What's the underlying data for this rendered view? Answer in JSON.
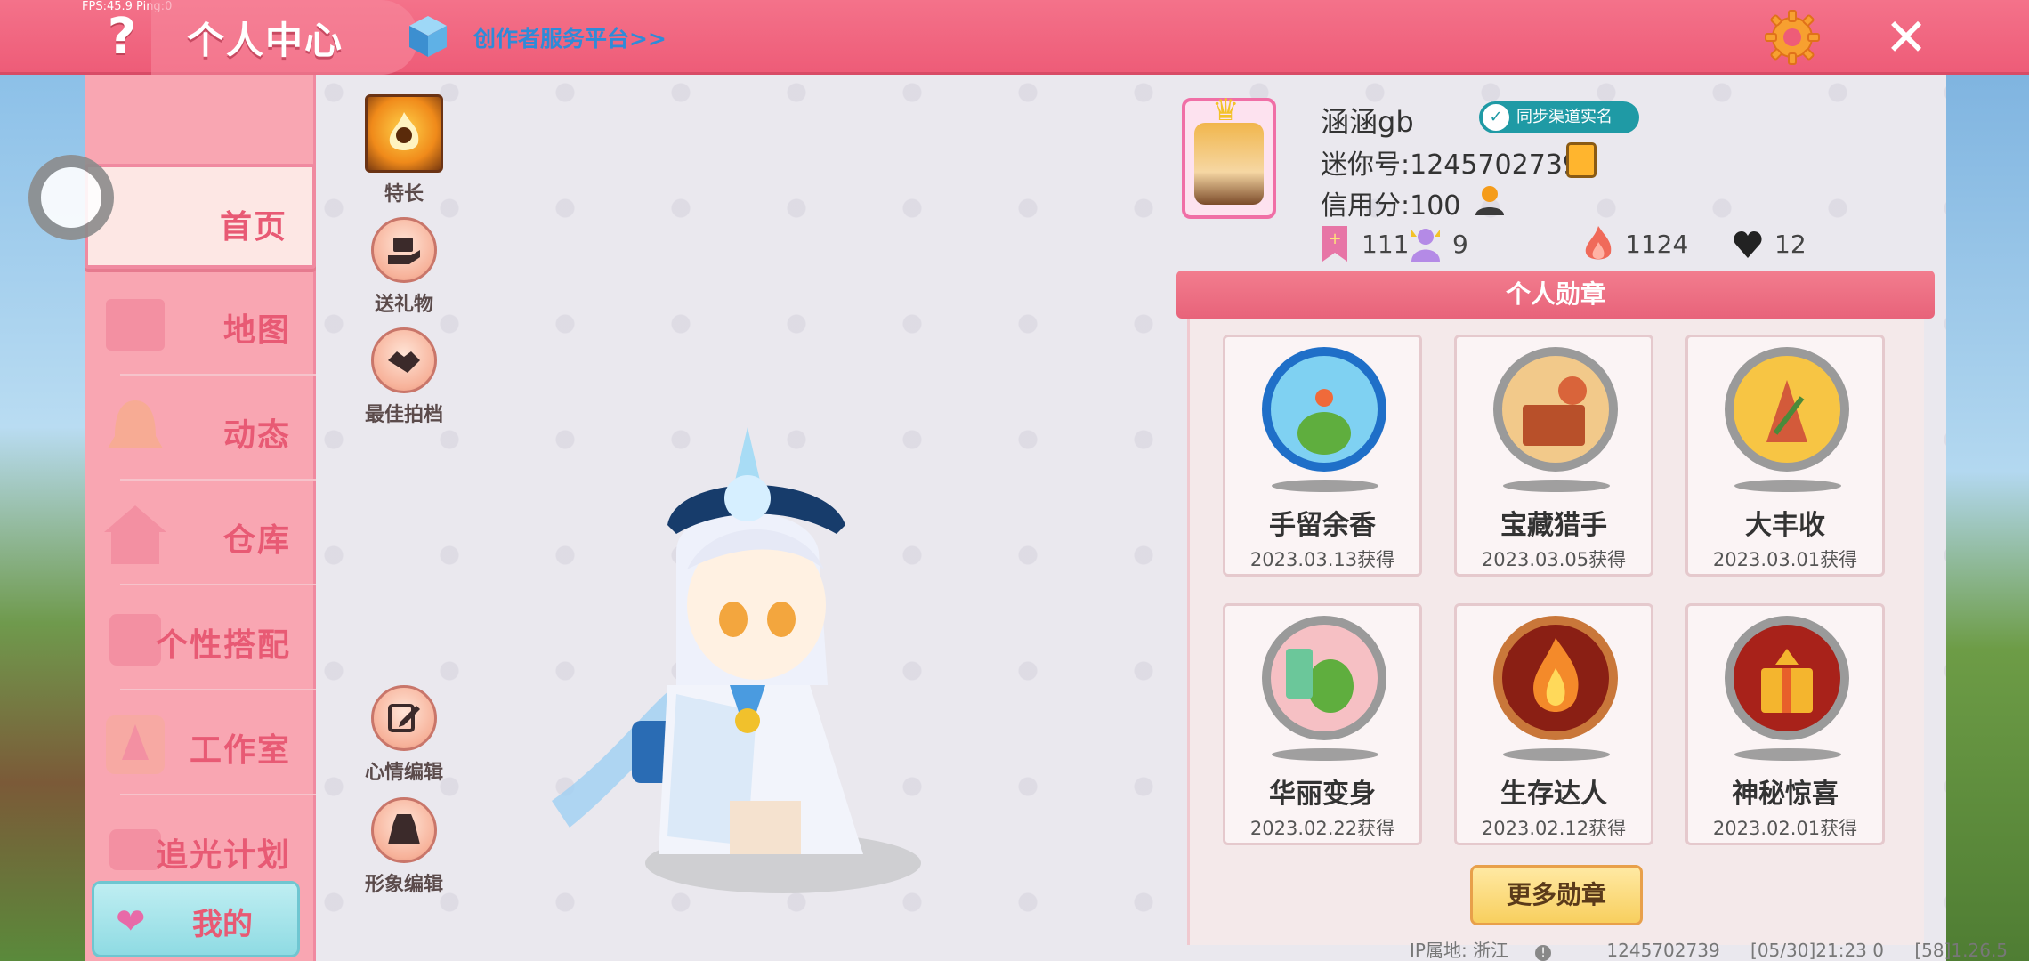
{
  "topbar": {
    "fps": "FPS:45.9  Ping:0",
    "help_icon": "question-mark-icon",
    "title": "个人中心",
    "creator_link": "创作者服务平台>>",
    "settings_icon": "gear-icon",
    "close_icon": "close-icon"
  },
  "sidebar": {
    "items": [
      {
        "label": "首页",
        "active": true
      },
      {
        "label": "地图"
      },
      {
        "label": "动态"
      },
      {
        "label": "仓库"
      },
      {
        "label": "个性搭配"
      },
      {
        "label": "工作室"
      },
      {
        "label": "追光计划"
      }
    ],
    "mine_label": "我的"
  },
  "actions": {
    "specialty": "特长",
    "gift": "送礼物",
    "best_photo": "最佳拍档",
    "mood_edit": "心情编辑",
    "look_edit": "形象编辑"
  },
  "profile": {
    "username": "涵涵gb",
    "sync_badge": "同步渠道实名",
    "mini_id": "迷你号:1245702739",
    "credit": "信用分:100",
    "stats": {
      "bookmark": "111",
      "fans": "9",
      "fire": "1124",
      "likes": "12"
    }
  },
  "medals": {
    "title": "个人勋章",
    "items": [
      {
        "name": "手留余香",
        "date": "2023.03.13获得"
      },
      {
        "name": "宝藏猎手",
        "date": "2023.03.05获得"
      },
      {
        "name": "大丰收",
        "date": "2023.03.01获得"
      },
      {
        "name": "华丽变身",
        "date": "2023.02.22获得"
      },
      {
        "name": "生存达人",
        "date": "2023.02.12获得"
      },
      {
        "name": "神秘惊喜",
        "date": "2023.02.01获得"
      }
    ],
    "more_button": "更多勋章"
  },
  "footer": {
    "ip": "IP属地: 浙江",
    "id": "1245702739",
    "time": "[05/30]21:23 0",
    "version": "[58]1.26.5"
  },
  "colors": {
    "topbar": "#ee5c78",
    "sidebar": "#f9a6b2",
    "accent_text": "#e85a74",
    "creator_link": "#2f8bd8",
    "sync_badge": "#1f9aa5"
  }
}
